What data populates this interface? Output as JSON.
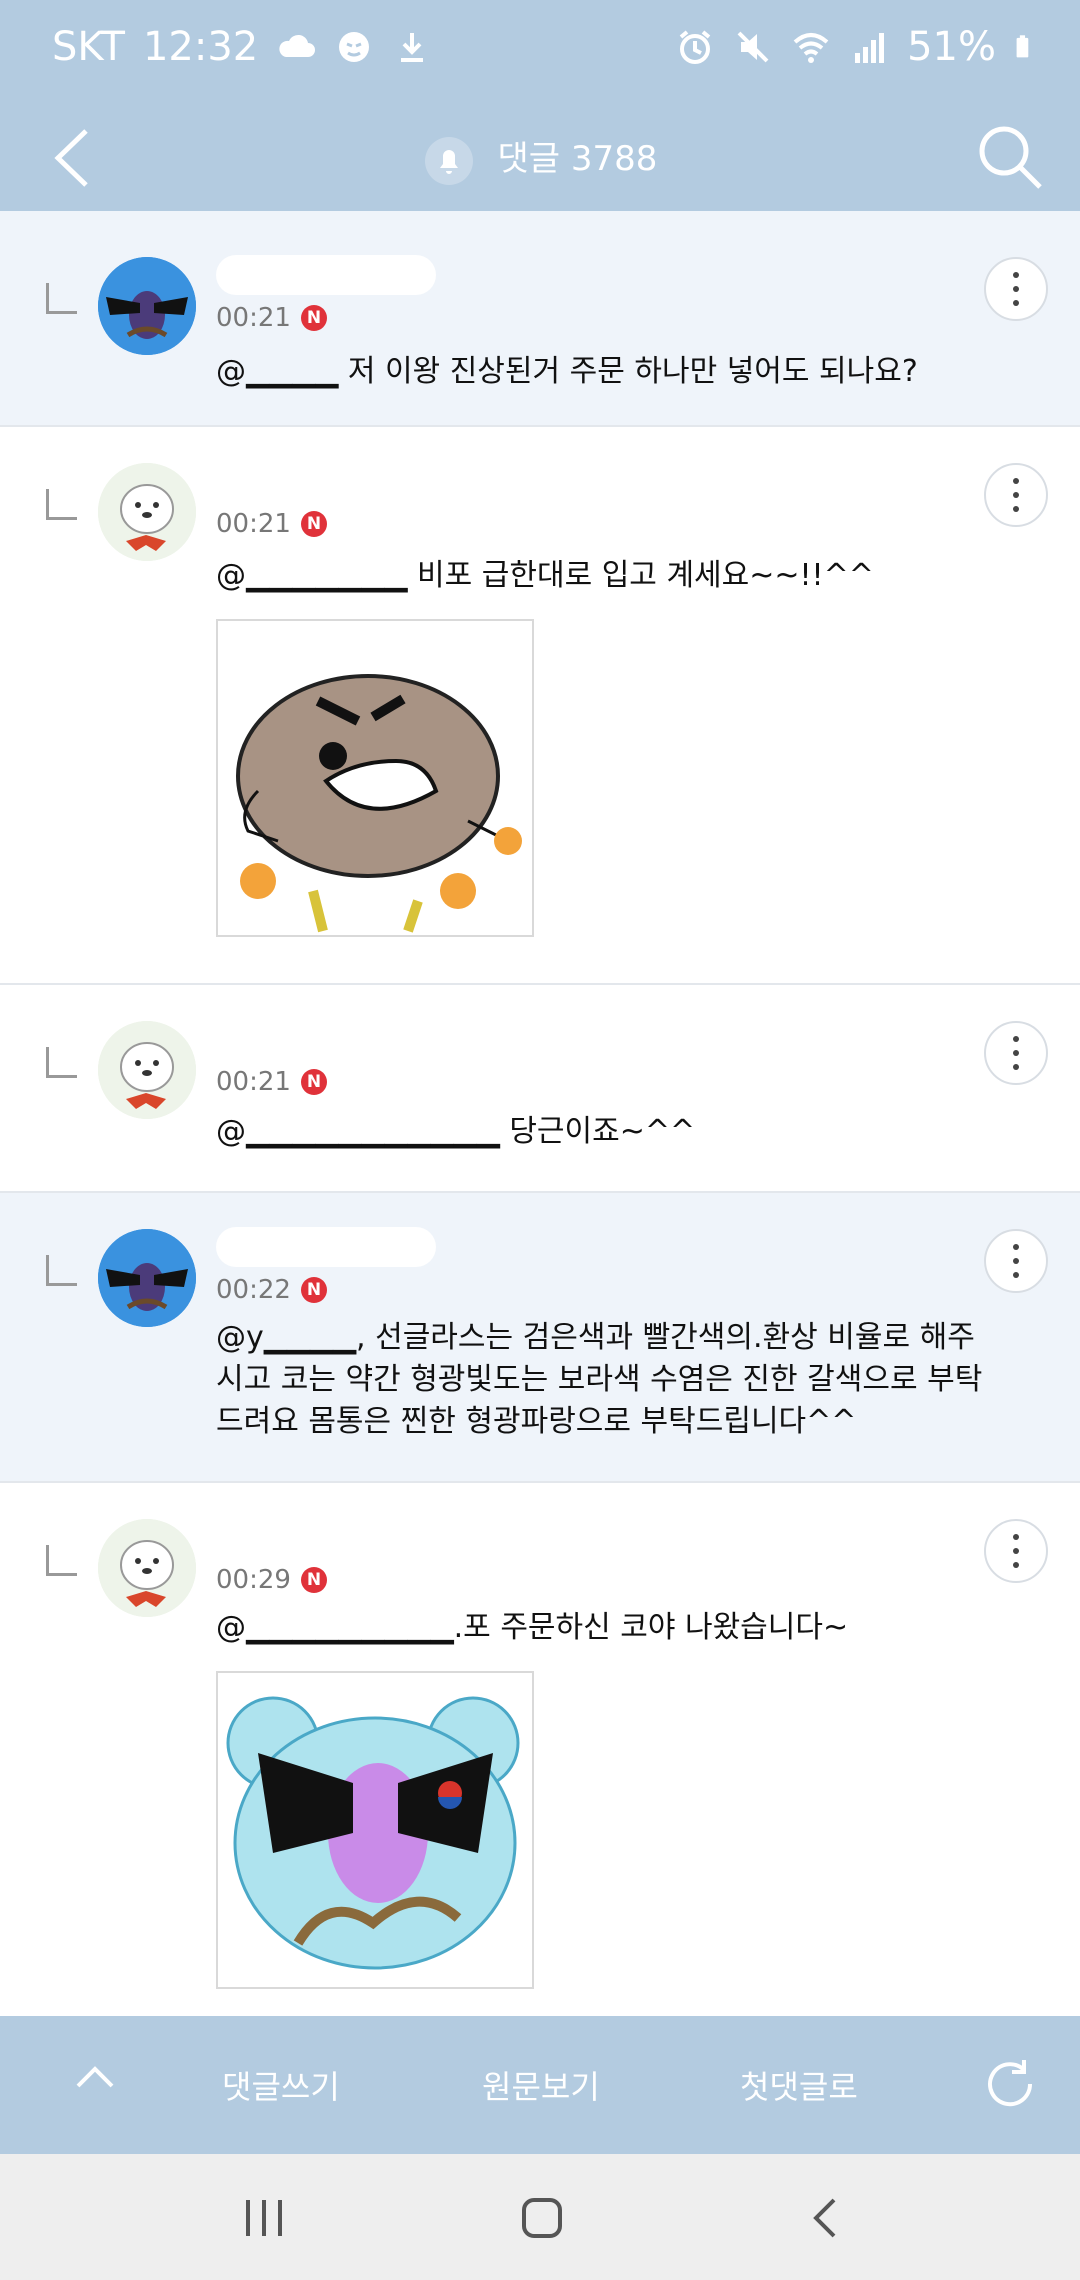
{
  "status_bar": {
    "carrier": "SKT",
    "time": "12:32",
    "battery": "51%",
    "left_icons": [
      "cloud-icon",
      "app-notification-icon",
      "download-icon"
    ],
    "right_icons": [
      "alarm-icon",
      "mute-icon",
      "wifi-icon",
      "signal-icon",
      "battery-icon"
    ]
  },
  "app_bar": {
    "title": "댓글 3788",
    "back_icon": "back-arrow-icon",
    "bell_icon": "bell-icon",
    "search_icon": "search-icon"
  },
  "comments": [
    {
      "author": "",
      "time": "00:21",
      "badge": "N",
      "text": "@▁▁▁▁ 저 이왕 진상된거 주문 하나만 넣어도 되나요?",
      "avatar": "sunglasses-avatar",
      "highlighted": true
    },
    {
      "author": "",
      "time": "00:21",
      "badge": "N",
      "text": "@▁▁▁▁▁▁▁ 비포 급한대로 입고 계세요~~!!^^",
      "avatar": "dog-avatar",
      "highlighted": false,
      "has_image": true
    },
    {
      "author": "",
      "time": "00:21",
      "badge": "N",
      "text": "@▁▁▁▁▁▁▁▁▁▁▁ 당근이죠~^^",
      "avatar": "dog-avatar",
      "highlighted": false
    },
    {
      "author": "",
      "time": "00:22",
      "badge": "N",
      "text": "@y▁▁▁▁, 선글라스는 검은색과 빨간색의.환상 비율로 해주시고 코는 약간 형광빛도는 보라색 수염은 진한 갈색으로 부탁드려요 몸통은 찐한 형광파랑으로 부탁드립니다^^",
      "avatar": "sunglasses-avatar",
      "highlighted": true
    },
    {
      "author": "",
      "time": "00:29",
      "badge": "N",
      "text": "@▁▁▁▁▁▁▁▁▁.포 주문하신 코야 나왔습니다~",
      "avatar": "dog-avatar",
      "highlighted": false,
      "has_image": true
    }
  ],
  "bottom_bar": {
    "up_icon": "chevron-up-icon",
    "write_comment": "댓글쓰기",
    "view_original": "원문보기",
    "first_comment": "첫댓글로",
    "refresh_icon": "refresh-icon"
  },
  "nav_bar": {
    "recents": "recents-icon",
    "home": "home-icon",
    "back": "back-icon"
  },
  "colors": {
    "bar": "#b3cbe0",
    "highlight_row": "#eff4fa",
    "badge": "#e0323a"
  }
}
